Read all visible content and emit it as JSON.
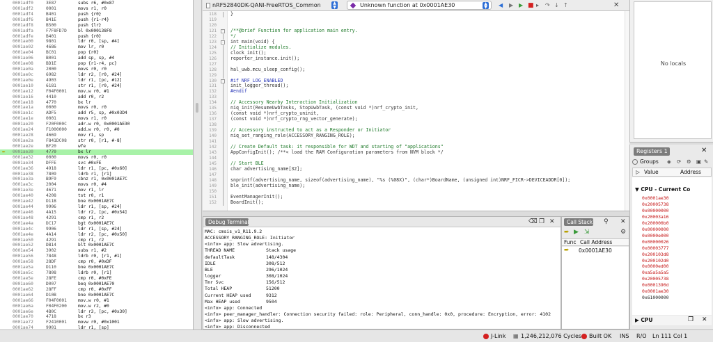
{
  "disassembly": {
    "current_index": 27,
    "rows": [
      {
        "addr": "0001adf0",
        "hex": "3E87",
        "ins": "subs r6, #0x87"
      },
      {
        "addr": "0001adf2",
        "hex": "0001",
        "ins": "movs r1, r0"
      },
      {
        "addr": "0001adf4",
        "hex": "B401",
        "ins": "push {r0}"
      },
      {
        "addr": "0001adf6",
        "hex": "B41E",
        "ins": "push {r1-r4}"
      },
      {
        "addr": "0001adf8",
        "hex": "B500",
        "ins": "push {lr}"
      },
      {
        "addr": "0001adfa",
        "hex": "F7F8FD7D",
        "ins": "bl 0x000138F8"
      },
      {
        "addr": "0001adfe",
        "hex": "B401",
        "ins": "push {r0}"
      },
      {
        "addr": "0001ae00",
        "hex": "9801",
        "ins": "ldr r0, [sp, #4]"
      },
      {
        "addr": "0001ae02",
        "hex": "4686",
        "ins": "mov lr, r0"
      },
      {
        "addr": "0001ae04",
        "hex": "BC01",
        "ins": "pop {r0}"
      },
      {
        "addr": "0001ae06",
        "hex": "B001",
        "ins": "add sp, sp, #4"
      },
      {
        "addr": "0001ae08",
        "hex": "BD1E",
        "ins": "pop {r1-r4, pc}"
      },
      {
        "addr": "0001ae0a",
        "hex": "2000",
        "ins": "movs r0, r0"
      },
      {
        "addr": "0001ae0c",
        "hex": "6982",
        "ins": "ldr r2, [r0, #24]"
      },
      {
        "addr": "0001ae0e",
        "hex": "4903",
        "ins": "ldr r1, [pc, #12]"
      },
      {
        "addr": "0001ae10",
        "hex": "6181",
        "ins": "str r1, [r0, #24]"
      },
      {
        "addr": "0001ae12",
        "hex": "F04F0001",
        "ins": "mov.w r0, #1"
      },
      {
        "addr": "0001ae16",
        "hex": "4410",
        "ins": "add r0, r2"
      },
      {
        "addr": "0001ae18",
        "hex": "4770",
        "ins": "bx lr"
      },
      {
        "addr": "0001ae1a",
        "hex": "0000",
        "ins": "movs r0, r0"
      },
      {
        "addr": "0001ae1c",
        "hex": "ADF5",
        "ins": "add r5, sp, #0x03D4"
      },
      {
        "addr": "0001ae1e",
        "hex": "0001",
        "ins": "movs r1, r0"
      },
      {
        "addr": "0001ae20",
        "hex": "F20F000C",
        "ins": "adr.w r0, 0x0001AE30"
      },
      {
        "addr": "0001ae24",
        "hex": "F1000000",
        "ins": "add.w r0, r0, #0"
      },
      {
        "addr": "0001ae28",
        "hex": "4669",
        "ins": "mov r1, sp"
      },
      {
        "addr": "0001ae2a",
        "hex": "F841DC08",
        "ins": "str r0, [r1, #-8]"
      },
      {
        "addr": "0001ae2e",
        "hex": "BF20",
        "ins": "wfe"
      },
      {
        "addr": "0001ae30",
        "hex": "4770",
        "ins": "bx lr"
      },
      {
        "addr": "0001ae32",
        "hex": "0000",
        "ins": "movs r0, r0"
      },
      {
        "addr": "0001ae34",
        "hex": "DFFE",
        "ins": "svc #0xFE"
      },
      {
        "addr": "0001ae36",
        "hex": "4918",
        "ins": "ldr r1, [pc, #0x60]"
      },
      {
        "addr": "0001ae38",
        "hex": "7809",
        "ins": "ldrb r1, [r1]"
      },
      {
        "addr": "0001ae3a",
        "hex": "B9F9",
        "ins": "cbnz r1, 0x0001AE7C"
      },
      {
        "addr": "0001ae3c",
        "hex": "2004",
        "ins": "movs r0, #4"
      },
      {
        "addr": "0001ae3e",
        "hex": "4671",
        "ins": "mov r1, lr"
      },
      {
        "addr": "0001ae40",
        "hex": "4208",
        "ins": "tst r0, r1"
      },
      {
        "addr": "0001ae42",
        "hex": "D11B",
        "ins": "bne 0x0001AE7C"
      },
      {
        "addr": "0001ae44",
        "hex": "9906",
        "ins": "ldr r1, [sp, #24]"
      },
      {
        "addr": "0001ae46",
        "hex": "4A15",
        "ins": "ldr r2, [pc, #0x54]"
      },
      {
        "addr": "0001ae48",
        "hex": "4291",
        "ins": "cmp r1, r2"
      },
      {
        "addr": "0001ae4a",
        "hex": "DC17",
        "ins": "bgt 0x0001AE7C"
      },
      {
        "addr": "0001ae4c",
        "hex": "9906",
        "ins": "ldr r1, [sp, #24]"
      },
      {
        "addr": "0001ae4e",
        "hex": "4A14",
        "ins": "ldr r2, [pc, #0x50]"
      },
      {
        "addr": "0001ae50",
        "hex": "4291",
        "ins": "cmp r1, r2"
      },
      {
        "addr": "0001ae52",
        "hex": "DB14",
        "ins": "blt 0x0001AE7C"
      },
      {
        "addr": "0001ae54",
        "hex": "3902",
        "ins": "subs r1, #2"
      },
      {
        "addr": "0001ae56",
        "hex": "7848",
        "ins": "ldrb r0, [r1, #1]"
      },
      {
        "addr": "0001ae58",
        "hex": "28DF",
        "ins": "cmp r0, #0xDF"
      },
      {
        "addr": "0001ae5a",
        "hex": "D110",
        "ins": "bne 0x0001AE7C"
      },
      {
        "addr": "0001ae5c",
        "hex": "7808",
        "ins": "ldrb r0, [r1]"
      },
      {
        "addr": "0001ae5e",
        "hex": "28FE",
        "ins": "cmp r0, #0xFE"
      },
      {
        "addr": "0001ae60",
        "hex": "D007",
        "ins": "beq 0x0001AE70"
      },
      {
        "addr": "0001ae62",
        "hex": "28FF",
        "ins": "cmp r0, #0xFF"
      },
      {
        "addr": "0001ae64",
        "hex": "D10B",
        "ins": "bne 0x0001AE7C"
      },
      {
        "addr": "0001ae66",
        "hex": "F04F0001",
        "ins": "mov.w r0, #1"
      },
      {
        "addr": "0001ae6a",
        "hex": "F04F0200",
        "ins": "mov.w r2, #0"
      },
      {
        "addr": "0001ae6e",
        "hex": "4B0C",
        "ins": "ldr r3, [pc, #0x30]"
      },
      {
        "addr": "0001ae70",
        "hex": "4718",
        "ins": "bx r3"
      },
      {
        "addr": "0001ae72",
        "hex": "F2410001",
        "ins": "movw r0, #0x1001"
      },
      {
        "addr": "0001ae74",
        "hex": "9901",
        "ins": "ldr r1, [sp]"
      }
    ]
  },
  "editor": {
    "file_name": "nRF52840DK-QANI-FreeRTOS_Common",
    "function_name": "Unknown function at 0x0001AE30",
    "lines": [
      {
        "ln": "118",
        "fold": "",
        "bar": true,
        "text": "}",
        "cls": "c-def"
      },
      {
        "ln": "119",
        "fold": "",
        "bar": false,
        "text": "",
        "cls": "c-def"
      },
      {
        "ln": "120",
        "fold": "",
        "bar": false,
        "text": "",
        "cls": "c-def"
      },
      {
        "ln": "121",
        "fold": "-",
        "bar": false,
        "text": "/**@brief Function for application main entry.",
        "cls": "c-com"
      },
      {
        "ln": "122",
        "fold": "",
        "bar": true,
        "text": " */",
        "cls": "c-com"
      },
      {
        "ln": "123",
        "fold": "-",
        "bar": false,
        "text": "int main(void) {",
        "cls": "c-def"
      },
      {
        "ln": "124",
        "fold": "",
        "bar": true,
        "text": "    // Initialize modules.",
        "cls": "c-com"
      },
      {
        "ln": "125",
        "fold": "",
        "bar": true,
        "text": "    clock_init();",
        "cls": "c-def"
      },
      {
        "ln": "126",
        "fold": "",
        "bar": true,
        "text": "    reporter_instance.init();",
        "cls": "c-def"
      },
      {
        "ln": "127",
        "fold": "",
        "bar": true,
        "text": "",
        "cls": "c-def"
      },
      {
        "ln": "128",
        "fold": "",
        "bar": true,
        "text": "    hal_uwb.mcu_sleep_config();",
        "cls": "c-def"
      },
      {
        "ln": "129",
        "fold": "",
        "bar": true,
        "text": "",
        "cls": "c-def"
      },
      {
        "ln": "130",
        "fold": "-",
        "bar": false,
        "text": "#if NRF_LOG_ENABLED",
        "cls": "c-pre"
      },
      {
        "ln": "131",
        "fold": "",
        "bar": true,
        "text": "    init_logger_thread();",
        "cls": "c-def"
      },
      {
        "ln": "132",
        "fold": "",
        "bar": true,
        "text": "#endif",
        "cls": "c-pre"
      },
      {
        "ln": "133",
        "fold": "",
        "bar": true,
        "text": "",
        "cls": "c-def"
      },
      {
        "ln": "134",
        "fold": "",
        "bar": true,
        "text": "    // Accessory Nearby Interaction Initialization",
        "cls": "c-com"
      },
      {
        "ln": "135",
        "fold": "",
        "bar": true,
        "text": "    niq_init(ResumeUwbTasks, StopUwbTask, (const void *)nrf_crypto_init,",
        "cls": "c-def"
      },
      {
        "ln": "136",
        "fold": "",
        "bar": true,
        "text": "                (const void *)nrf_crypto_uninit,",
        "cls": "c-def"
      },
      {
        "ln": "137",
        "fold": "",
        "bar": true,
        "text": "                (const void *)nrf_crypto_rng_vector_generate);",
        "cls": "c-def"
      },
      {
        "ln": "138",
        "fold": "",
        "bar": true,
        "text": "",
        "cls": "c-def"
      },
      {
        "ln": "139",
        "fold": "",
        "bar": true,
        "text": "    // Accessory instructed to act as a Responder or Initiator",
        "cls": "c-com"
      },
      {
        "ln": "140",
        "fold": "",
        "bar": true,
        "text": "    niq_set_ranging_role(ACCESSORY_RANGING_ROLE);",
        "cls": "c-def"
      },
      {
        "ln": "141",
        "fold": "",
        "bar": true,
        "text": "",
        "cls": "c-def"
      },
      {
        "ln": "142",
        "fold": "",
        "bar": true,
        "text": "    // Create Default task: it responsible for WDT and starting of \"applications\"",
        "cls": "c-com"
      },
      {
        "ln": "143",
        "fold": "",
        "bar": true,
        "text": "    AppConfigInit(); /**< load the RAM Configuration parameters from NVM block */",
        "cls": "c-def"
      },
      {
        "ln": "144",
        "fold": "",
        "bar": true,
        "text": "",
        "cls": "c-def"
      },
      {
        "ln": "145",
        "fold": "",
        "bar": true,
        "text": "    // Start BLE",
        "cls": "c-com"
      },
      {
        "ln": "146",
        "fold": "",
        "bar": true,
        "text": "    char advertising_name[32];",
        "cls": "c-def"
      },
      {
        "ln": "147",
        "fold": "",
        "bar": true,
        "text": "",
        "cls": "c-def"
      },
      {
        "ln": "148",
        "fold": "",
        "bar": true,
        "text": "    snprintf(advertising_name, sizeof(advertising_name), \"%s (%08X)\", (char*)BoardName, (unsigned int)NRF_FICR->DEVICEADDR[0]);",
        "cls": "c-def"
      },
      {
        "ln": "149",
        "fold": "",
        "bar": true,
        "text": "    ble_init(advertising_name);",
        "cls": "c-def"
      },
      {
        "ln": "150",
        "fold": "",
        "bar": true,
        "text": "",
        "cls": "c-def"
      },
      {
        "ln": "151",
        "fold": "",
        "bar": true,
        "text": "    EventManagerInit();",
        "cls": "c-def"
      },
      {
        "ln": "152",
        "fold": "",
        "bar": true,
        "text": "    BoardInit();",
        "cls": "c-def"
      }
    ]
  },
  "locals": {
    "empty_text": "No locals"
  },
  "registers": {
    "tab_label": "Registers 1",
    "groups_label": "Groups",
    "col_value": "Value",
    "col_address": "Address",
    "group_title": "CPU - Current Co",
    "values": [
      {
        "v": "0x0001ae30",
        "red": true
      },
      {
        "v": "0x20005738",
        "red": true
      },
      {
        "v": "0x00000000",
        "red": true
      },
      {
        "v": "0x20003a16",
        "red": true
      },
      {
        "v": "0x200000b0",
        "red": true
      },
      {
        "v": "0x00000000",
        "red": true
      },
      {
        "v": "0x0000e000",
        "red": true
      },
      {
        "v": "0x00000026",
        "red": true
      },
      {
        "v": "0x00003777",
        "red": true
      },
      {
        "v": "0x200103d8",
        "red": true
      },
      {
        "v": "0x200102d0",
        "red": true
      },
      {
        "v": "0x0000ed00",
        "red": true
      },
      {
        "v": "0xa5a5a5a5",
        "red": true
      },
      {
        "v": "0x20005738",
        "red": true
      },
      {
        "v": "0x0001390d",
        "red": true
      },
      {
        "v": "0x0001ae30",
        "red": true
      },
      {
        "v": "0x61000000",
        "red": false
      }
    ],
    "bottom_group": "CPU"
  },
  "terminal": {
    "tab_label": "Debug Terminal",
    "lines": [
      {
        "a": "MAC: cmsis_v1_R11.9.2",
        "b": ""
      },
      {
        "a": "ACCESSORY_RANGING_ROLE: Initiator",
        "b": ""
      },
      {
        "a": "<info> app: Slow advertising.",
        "b": ""
      },
      {
        "a": "THREAD NAME",
        "b": "Stack usage"
      },
      {
        "a": "defaultTask",
        "b": "148/4304"
      },
      {
        "a": "IDLE",
        "b": "308/512"
      },
      {
        "a": "BLE",
        "b": "296/1024"
      },
      {
        "a": "logger",
        "b": "308/1024"
      },
      {
        "a": "Tmr Svc",
        "b": "156/512"
      },
      {
        "a": "Total HEAP",
        "b": "51200"
      },
      {
        "a": "Current HEAP used",
        "b": "9312"
      },
      {
        "a": "Max HEAP used",
        "b": "9504"
      },
      {
        "a": "<info> app: Connected",
        "b": ""
      },
      {
        "a": "<info> peer_manager_handler: Connection security failed: role: Peripheral, conn_handle: 0x0, procedure: Encryption, error: 4102",
        "b": ""
      },
      {
        "a": "<info> app: Slow advertising.",
        "b": ""
      },
      {
        "a": "<info> app: Disconnected",
        "b": ""
      }
    ]
  },
  "callstack": {
    "tab_label": "Call Stack",
    "col_func": "Func",
    "col_address": "Call Address",
    "frame": "0x0001AE30"
  },
  "status": {
    "jlink": "J-Link",
    "cycles": "1,246,212,076 Cycles",
    "build": "Built OK",
    "ins": "INS",
    "ro": "R/O",
    "pos": "Ln 111 Col 1"
  },
  "colors": {
    "current_line": "#a8f2a8",
    "changed_register": "#c41212",
    "accent": "#2e6fd6"
  }
}
